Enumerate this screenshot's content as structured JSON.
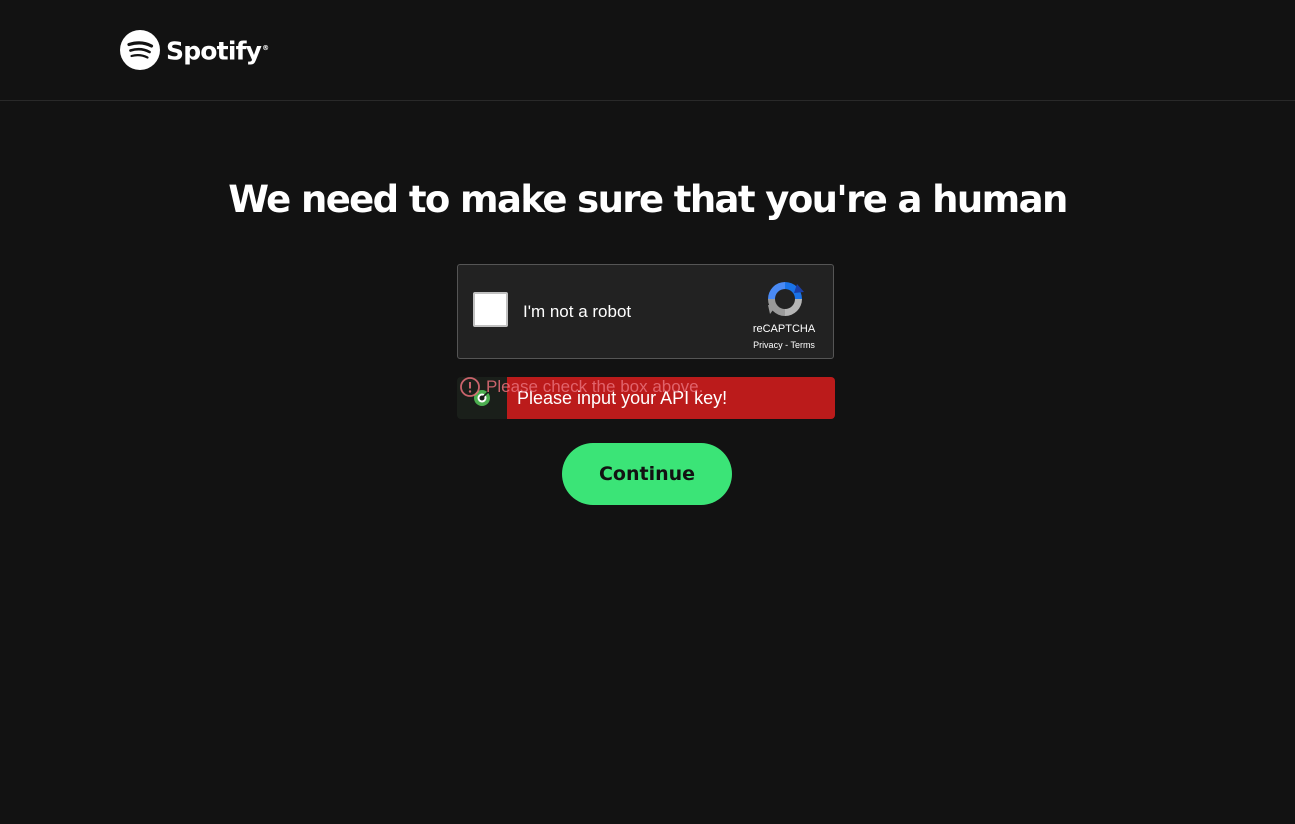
{
  "header": {
    "brand_name": "Spotify",
    "brand_registered_mark": "®"
  },
  "main": {
    "title": "We need to make sure that you're a human",
    "continue_label": "Continue"
  },
  "recaptcha": {
    "checkbox_label": "I'm not a robot",
    "brand": "reCAPTCHA",
    "privacy_link": "Privacy",
    "separator": "-",
    "terms_link": "Terms",
    "error_text": "Please check the box above."
  },
  "toast": {
    "message": "Please input your API key!"
  },
  "colors": {
    "background": "#121212",
    "accent_green": "#3be477",
    "toast_red": "#bb1b1b",
    "error_pink": "#e8707a"
  },
  "icons": [
    "spotify-logo-icon",
    "recaptcha-logo-icon",
    "error-circle-icon",
    "extension-target-icon"
  ]
}
